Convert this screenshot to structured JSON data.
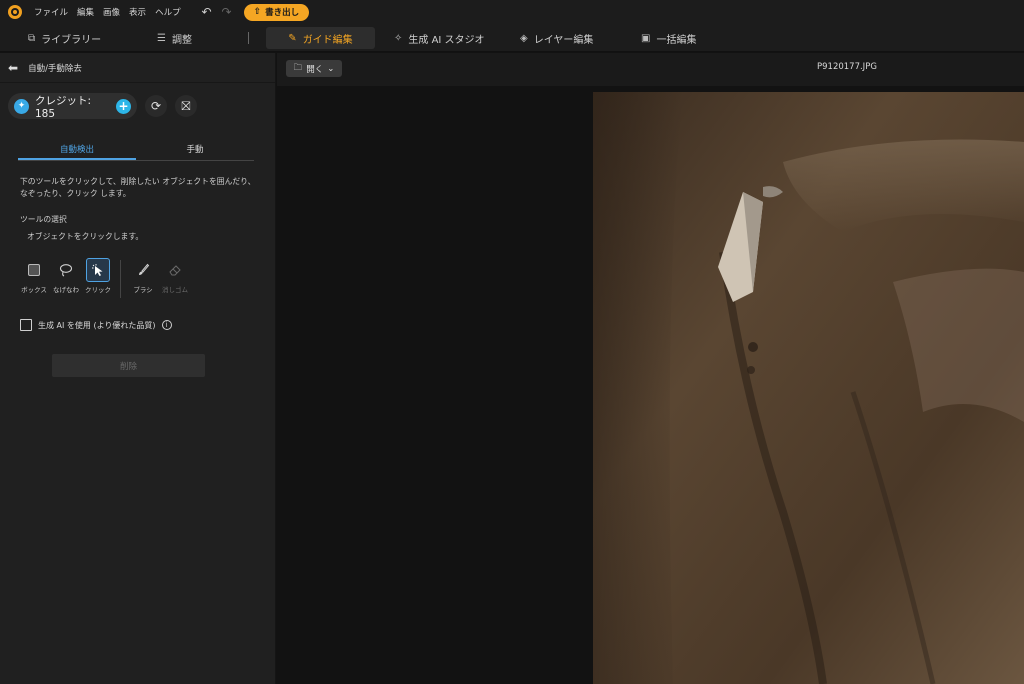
{
  "menu": {
    "items": [
      "ファイル",
      "編集",
      "画像",
      "表示",
      "ヘルプ"
    ],
    "export_label": "書き出し"
  },
  "modes": {
    "library": "ライブラリー",
    "adjust": "調整",
    "guided_edit": "ガイド編集",
    "gen_ai_studio": "生成 AI スタジオ",
    "layer_edit": "レイヤー編集",
    "batch_edit": "一括編集"
  },
  "panel": {
    "title": "自動/手動除去",
    "credit_label": "クレジット: 185",
    "tabs": {
      "auto": "自動検出",
      "manual": "手動"
    },
    "description": "下のツールをクリックして、削除したい オブジェクトを囲んだり、なぞったり、クリック します。",
    "tool_heading": "ツールの選択",
    "tool_hint": "オブジェクトをクリックします。",
    "tools": {
      "box": "ボックス",
      "lasso": "なげなわ",
      "click": "クリック",
      "brush": "ブラシ",
      "eraser": "消しゴム"
    },
    "gen_ai_label": "生成 AI を使用 (より優れた品質)",
    "remove_label": "削除"
  },
  "canvas": {
    "open_label": "開く",
    "filename": "P9120177.JPG"
  },
  "colors": {
    "accent": "#f5a623",
    "tab_active": "#4fa3e3",
    "credit_blue": "#2db6e8"
  }
}
